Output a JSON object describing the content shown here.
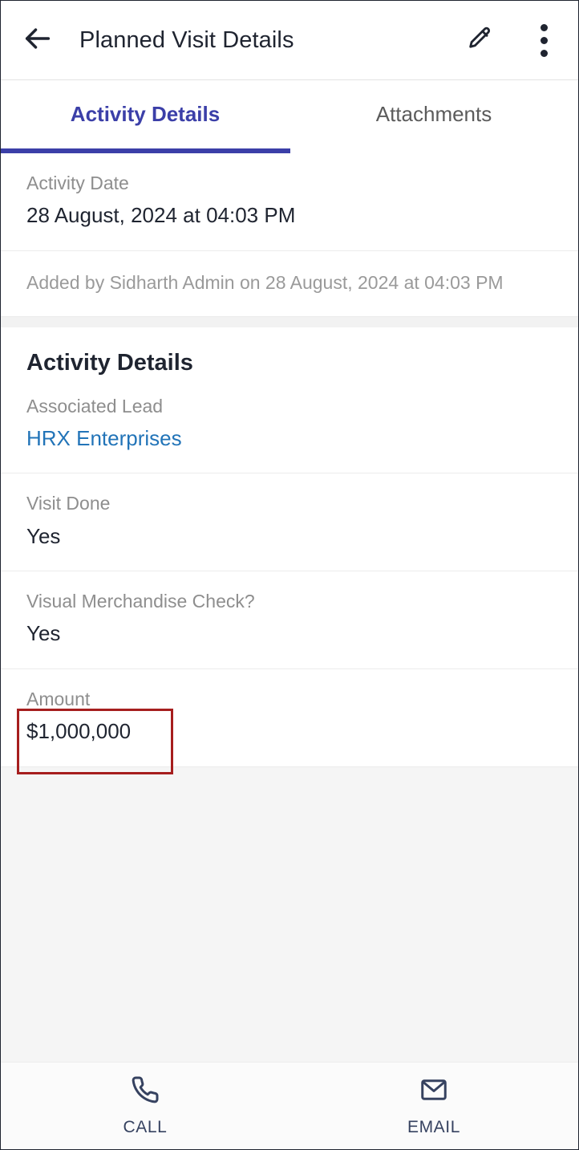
{
  "appbar": {
    "back_icon": "arrow-left-icon",
    "title": "Planned Visit Details",
    "edit_icon": "pencil-icon",
    "overflow_icon": "more-vertical-icon"
  },
  "tabs": {
    "active_index": 0,
    "items": [
      {
        "label": "Activity Details"
      },
      {
        "label": "Attachments"
      }
    ],
    "indicator_color": "#3b3fa8"
  },
  "date_card": {
    "label": "Activity Date",
    "value": "28 August, 2024 at 04:03 PM",
    "meta": "Added by Sidharth Admin on 28 August, 2024 at 04:03 PM"
  },
  "details": {
    "section_title": "Activity Details",
    "fields": [
      {
        "label": "Associated Lead",
        "value": "HRX Enterprises",
        "is_link": true
      },
      {
        "label": "Visit Done",
        "value": "Yes",
        "is_link": false
      },
      {
        "label": "Visual Merchandise Check?",
        "value": "Yes",
        "is_link": false
      },
      {
        "label": "Amount",
        "value": "$1,000,000",
        "is_link": false
      }
    ]
  },
  "annotation": {
    "target": "Amount",
    "color": "#a61e1e"
  },
  "bottombar": {
    "actions": [
      {
        "icon": "phone-icon",
        "label": "CALL"
      },
      {
        "icon": "mail-icon",
        "label": "EMAIL"
      }
    ]
  },
  "colors": {
    "accent": "#3b3fa8",
    "link": "#2274b8",
    "text": "#1f2430",
    "muted": "#8e8e8e",
    "bottom_icon": "#364260"
  }
}
